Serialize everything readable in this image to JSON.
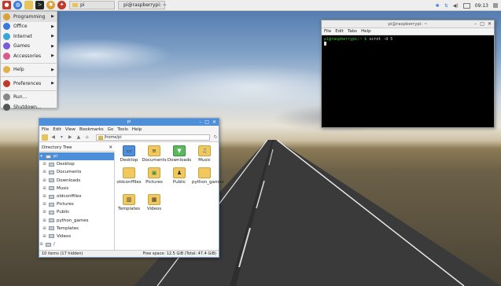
{
  "taskbar": {
    "tasks": [
      {
        "label": "pi",
        "icon": "folder-icon"
      },
      {
        "label": "pi@raspberrypi: ~",
        "icon": "terminal-icon"
      }
    ],
    "tray": {
      "clock": "09:13"
    }
  },
  "menu": {
    "items": [
      {
        "label": "Programming",
        "has_submenu": true,
        "icon_color": "#d8a23a"
      },
      {
        "label": "Office",
        "has_submenu": true,
        "icon_color": "#3a7ad8"
      },
      {
        "label": "Internet",
        "has_submenu": true,
        "icon_color": "#3aa6d8"
      },
      {
        "label": "Games",
        "has_submenu": true,
        "icon_color": "#7a5ad8"
      },
      {
        "label": "Accessories",
        "has_submenu": true,
        "icon_color": "#d85a8a"
      },
      {
        "label": "Help",
        "has_submenu": true,
        "icon_color": "#e0b24a"
      },
      {
        "label": "Preferences",
        "has_submenu": true,
        "icon_color": "#c0392b"
      },
      {
        "label": "Run...",
        "has_submenu": false,
        "icon_color": "#888888"
      },
      {
        "label": "Shutdown...",
        "has_submenu": false,
        "icon_color": "#555555"
      }
    ]
  },
  "terminal": {
    "title": "pi@raspberrypi: ~",
    "menu": [
      "File",
      "Edit",
      "Tabs",
      "Help"
    ],
    "prompt": "pi@raspberrypi:~ $",
    "command": " scrot -d 5"
  },
  "filemanager": {
    "title": "pi",
    "menu": [
      "File",
      "Edit",
      "View",
      "Bookmarks",
      "Go",
      "Tools",
      "Help"
    ],
    "address": "/home/pi",
    "pane_header": "Directory Tree",
    "tree": [
      {
        "label": "pi",
        "root": true
      },
      {
        "label": "Desktop"
      },
      {
        "label": "Documents"
      },
      {
        "label": "Downloads"
      },
      {
        "label": "Music"
      },
      {
        "label": "oldconffiles"
      },
      {
        "label": "Pictures"
      },
      {
        "label": "Public"
      },
      {
        "label": "python_games"
      },
      {
        "label": "Templates"
      },
      {
        "label": "Videos"
      },
      {
        "label": "/"
      }
    ],
    "grid": [
      {
        "label": "Desktop",
        "glyph": "▭"
      },
      {
        "label": "Documents",
        "glyph": "≡"
      },
      {
        "label": "Downloads",
        "glyph": "▼"
      },
      {
        "label": "Music",
        "glyph": "♫"
      },
      {
        "label": "oldconffiles",
        "glyph": ""
      },
      {
        "label": "Pictures",
        "glyph": "▣"
      },
      {
        "label": "Public",
        "glyph": "♟"
      },
      {
        "label": "python_games",
        "glyph": ""
      },
      {
        "label": "Templates",
        "glyph": "▥"
      },
      {
        "label": "Videos",
        "glyph": "▦"
      }
    ],
    "status_left": "10 items (17 hidden)",
    "status_right": "Free space: 12.5 GiB (Total: 47.4 GiB)"
  }
}
